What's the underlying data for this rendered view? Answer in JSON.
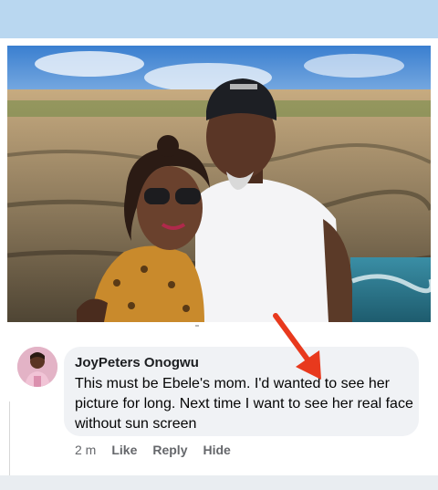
{
  "post": {
    "image_alt": "Couple posing by rocky seashore"
  },
  "comment": {
    "author": "JoyPeters Onogwu",
    "text": "This must be Ebele's mom. I'd wanted to see her picture for long. Next time I want to see her real face without sun screen",
    "time": "2 m",
    "actions": {
      "like": "Like",
      "reply": "Reply",
      "hide": "Hide"
    }
  },
  "colors": {
    "top_bar": "#b9d7f0",
    "bubble": "#f0f2f5",
    "arrow": "#e8391d",
    "meta_text": "#65676b"
  },
  "icons": {
    "annotation": "red-arrow-icon"
  }
}
